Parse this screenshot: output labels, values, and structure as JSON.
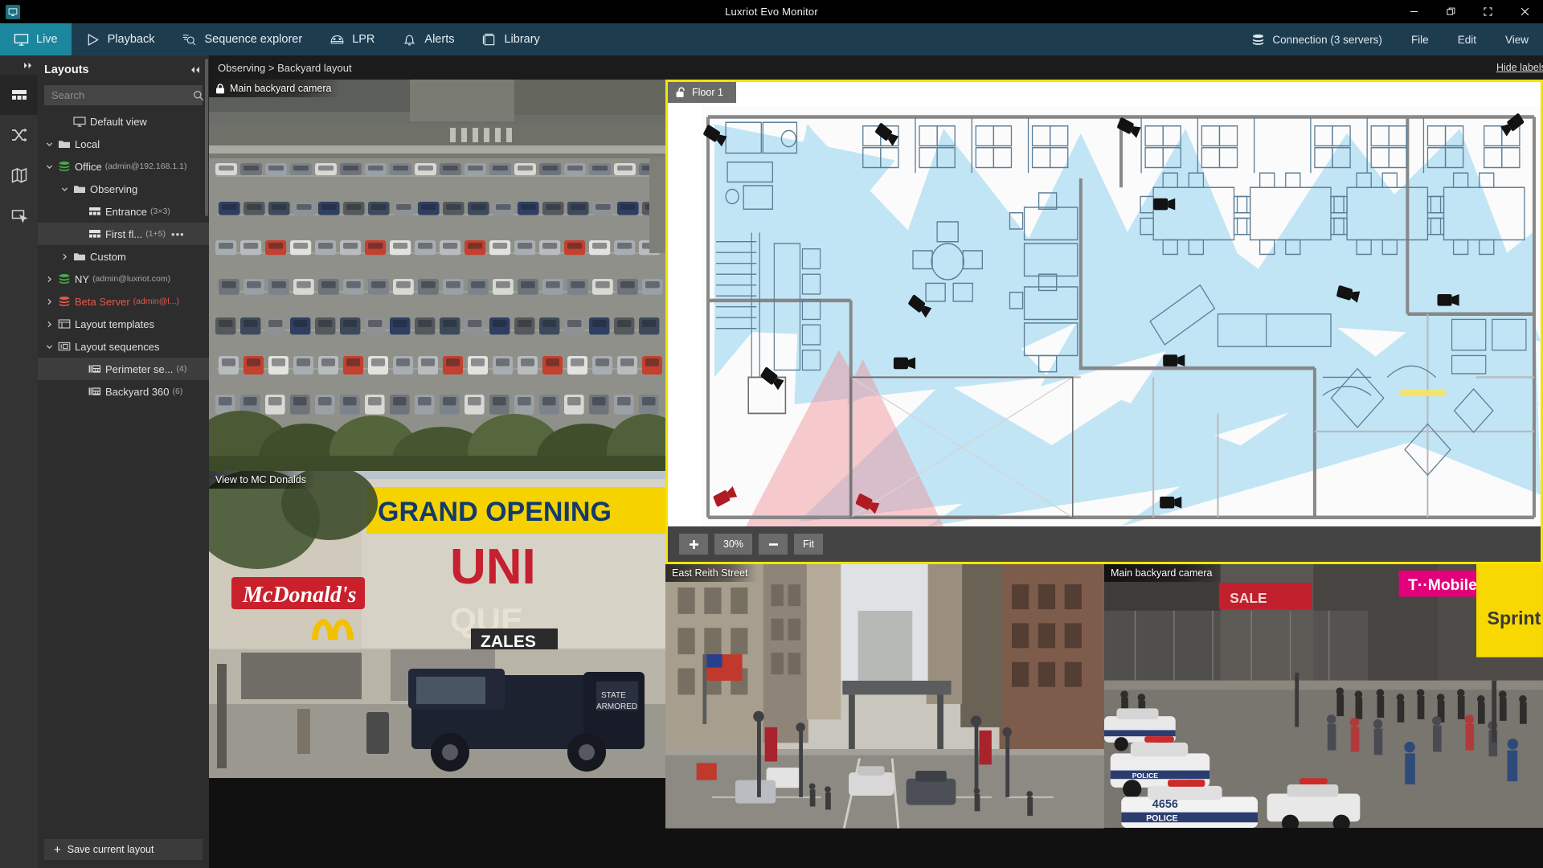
{
  "window": {
    "title": "Luxriot Evo Monitor",
    "app_icon": "monitor-icon",
    "controls": {
      "minimize": "minimize-icon",
      "restore": "restore-icon",
      "fullscreen": "fullscreen-icon",
      "close": "close-icon"
    }
  },
  "menubar": {
    "tabs": [
      {
        "label": "Live",
        "icon": "monitor-icon",
        "active": true
      },
      {
        "label": "Playback",
        "icon": "play-icon",
        "active": false
      },
      {
        "label": "Sequence explorer",
        "icon": "sequence-icon",
        "active": false
      },
      {
        "label": "LPR",
        "icon": "car-plate-icon",
        "active": false
      },
      {
        "label": "Alerts",
        "icon": "bell-icon",
        "active": false
      },
      {
        "label": "Library",
        "icon": "library-icon",
        "active": false
      }
    ],
    "right": [
      {
        "label": "Connection (3 servers)",
        "icon": "servers-icon"
      },
      {
        "label": "File",
        "icon": null
      },
      {
        "label": "Edit",
        "icon": null
      },
      {
        "label": "View",
        "icon": null
      }
    ]
  },
  "rail": {
    "expand_icon": "double-chevron-right-icon",
    "items": [
      {
        "icon": "layouts-grid-icon",
        "active": true
      },
      {
        "icon": "shuffle-icon",
        "active": false
      },
      {
        "icon": "map-icon",
        "active": false
      },
      {
        "icon": "screen-pointer-icon",
        "active": false
      }
    ]
  },
  "panel": {
    "title": "Layouts",
    "collapse_icon": "double-chevron-left-icon",
    "search": {
      "placeholder": "Search",
      "value": "",
      "icon": "search-icon"
    },
    "tree": [
      {
        "label": "Default view",
        "count": "",
        "icon": "monitor-icon",
        "arrow": "none",
        "indent": 1,
        "selected": false,
        "red": false,
        "dots": false
      },
      {
        "label": "Local",
        "count": "",
        "icon": "folder-icon",
        "arrow": "down",
        "indent": 0,
        "selected": false,
        "red": false,
        "dots": false
      },
      {
        "label": "Office",
        "count": "(admin@192.168.1.1)",
        "icon": "server-green-icon",
        "arrow": "down",
        "indent": 0,
        "selected": false,
        "red": false,
        "dots": false
      },
      {
        "label": "Observing",
        "count": "",
        "icon": "folder-icon",
        "arrow": "down",
        "indent": 1,
        "selected": false,
        "red": false,
        "dots": false
      },
      {
        "label": "Entrance",
        "count": "(3×3)",
        "icon": "layout-icon",
        "arrow": "none",
        "indent": 2,
        "selected": false,
        "red": false,
        "dots": false
      },
      {
        "label": "First fl...",
        "count": "(1+5)",
        "icon": "layout-icon",
        "arrow": "none",
        "indent": 2,
        "selected": true,
        "red": false,
        "dots": true
      },
      {
        "label": "Custom",
        "count": "",
        "icon": "folder-icon",
        "arrow": "right",
        "indent": 1,
        "selected": false,
        "red": false,
        "dots": false
      },
      {
        "label": "NY",
        "count": "(admin@luxriot.com)",
        "icon": "server-green-icon",
        "arrow": "right",
        "indent": 0,
        "selected": false,
        "red": false,
        "dots": false
      },
      {
        "label": "Beta Server",
        "count": "(admin@l...)",
        "icon": "server-red-icon",
        "arrow": "right",
        "indent": 0,
        "selected": false,
        "red": true,
        "dots": false
      },
      {
        "label": "Layout templates",
        "count": "",
        "icon": "template-icon",
        "arrow": "right",
        "indent": 0,
        "selected": false,
        "red": false,
        "dots": false
      },
      {
        "label": "Layout sequences",
        "count": "",
        "icon": "sequence-list-icon",
        "arrow": "down",
        "indent": 0,
        "selected": false,
        "red": false,
        "dots": false
      },
      {
        "label": "Perimeter se...",
        "count": "(4)",
        "icon": "sequence-item-icon",
        "arrow": "none",
        "indent": 2,
        "selected": true,
        "red": false,
        "dots": false
      },
      {
        "label": "Backyard 360",
        "count": "(6)",
        "icon": "sequence-item-icon",
        "arrow": "none",
        "indent": 2,
        "selected": false,
        "red": false,
        "dots": false
      }
    ],
    "save_button": {
      "label": "Save current layout",
      "icon": "plus-icon"
    }
  },
  "breadcrumb": {
    "text": "Observing > Backyard layout",
    "hide_labels": "Hide labels"
  },
  "cells": {
    "main_backyard_top": {
      "label": "Main backyard camera",
      "icon": "lock-closed-icon"
    },
    "mcdonalds": {
      "label": "View to MC Donalds",
      "icon": null
    },
    "east_reith": {
      "label": "East Reith Street",
      "icon": null
    },
    "main_backyard_bottom": {
      "label": "Main backyard camera",
      "icon": null
    }
  },
  "map": {
    "tab_label": "Floor 1",
    "tab_icon": "lock-open-icon",
    "zoom_in": {
      "label": "+",
      "icon": "plus-icon"
    },
    "zoom_value": "30%",
    "zoom_out": {
      "label": "−",
      "icon": "minus-icon"
    },
    "fit": {
      "label": "Fit"
    },
    "border_color": "#f2e500"
  },
  "colors": {
    "accent": "#1b879e",
    "menubar": "#1d3d4f",
    "panel_bg": "#2d2d2d",
    "rail_bg": "#333333",
    "selection": "#3d3d3d",
    "error_red": "#e3584a",
    "map_border": "#f2e500",
    "fov_blue": "#9fd8f2",
    "fov_red": "#f5b8bc"
  }
}
